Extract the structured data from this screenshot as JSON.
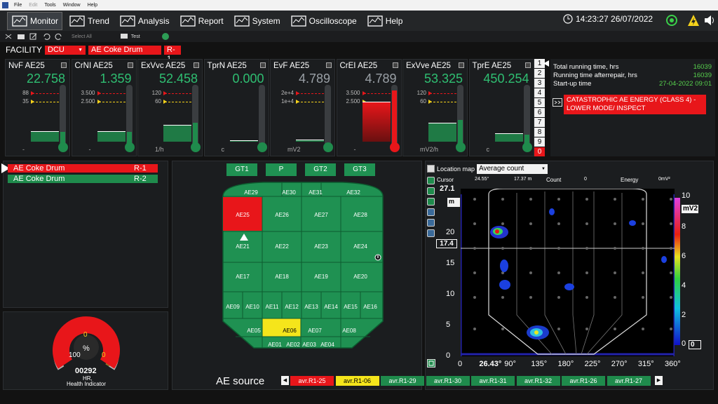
{
  "menu": [
    "File",
    "Edit",
    "Tools",
    "Window",
    "Help"
  ],
  "nav": [
    {
      "label": "Monitor",
      "icon": "monitor-icon"
    },
    {
      "label": "Trend",
      "icon": "trend-icon"
    },
    {
      "label": "Analysis",
      "icon": "analysis-icon"
    },
    {
      "label": "Report",
      "icon": "report-icon"
    },
    {
      "label": "System",
      "icon": "system-icon"
    },
    {
      "label": "Oscilloscope",
      "icon": "oscilloscope-icon"
    },
    {
      "label": "Help",
      "icon": "help-icon"
    }
  ],
  "clock": "14:23:27 26/07/2022",
  "toolbar2": {
    "select_all": "Select All",
    "test": "Test"
  },
  "facility": {
    "label": "FACILITY",
    "unit": "DCU",
    "object": "AE Coke Drum",
    "drum": "R-1"
  },
  "gauges": [
    {
      "name": "NvF AE25",
      "value": "22.758",
      "hi": "88",
      "lo": "35",
      "unit": "-",
      "fill": 0.25,
      "red": false,
      "grey": false
    },
    {
      "name": "CrNI AE25",
      "value": "1.359",
      "hi": "3.500",
      "lo": "2.500",
      "unit": "-",
      "fill": 0.25,
      "red": false,
      "grey": false
    },
    {
      "name": "ExVvc AE25",
      "value": "52.458",
      "hi": "120",
      "lo": "60",
      "unit": "1/h",
      "fill": 0.4,
      "red": false,
      "grey": false
    },
    {
      "name": "TprN AE25",
      "value": "0.000",
      "hi": "",
      "lo": "",
      "unit": "c",
      "fill": 0.02,
      "red": false,
      "grey": false
    },
    {
      "name": "EvF AE25",
      "value": "4.789",
      "hi": "2e+4",
      "lo": "1e+4",
      "unit": "mV2",
      "fill": 0.05,
      "red": false,
      "grey": true
    },
    {
      "name": "CrEI AE25",
      "value": "4.789",
      "hi": "3.500",
      "lo": "2.500",
      "unit": "-",
      "fill": 0.95,
      "red": true,
      "grey": true
    },
    {
      "name": "ExVve AE25",
      "value": "53.325",
      "hi": "120",
      "lo": "60",
      "unit": "mV2/h",
      "fill": 0.45,
      "red": false,
      "grey": false
    },
    {
      "name": "TprE AE25",
      "value": "450.254",
      "hi": "",
      "lo": "",
      "unit": "c",
      "fill": 0.2,
      "red": false,
      "grey": false
    }
  ],
  "severity": [
    "1",
    "2",
    "3",
    "4",
    "5",
    "6",
    "7",
    "8",
    "9",
    "0"
  ],
  "info": {
    "total_label": "Total running time, hrs",
    "total": "16039",
    "after_label": "Running time afterrepair, hrs",
    "after": "16039",
    "startup_label": "Start-up time",
    "startup": "27-04-2022 09:01",
    "alarm": "CATASTROPHIC AE ENERGY (CLASS 4) - LOWER MODE/ INSPECT"
  },
  "objects": [
    {
      "name": "AE Coke Drum",
      "drum": "R-1",
      "status": "red"
    },
    {
      "name": "AE Coke Drum",
      "drum": "R-2",
      "status": "green"
    }
  ],
  "health": {
    "top": "0",
    "pct": "%",
    "min": "100",
    "max": "0",
    "value": "00292",
    "unit": "HR,",
    "label": "Health Indicator"
  },
  "gt": [
    "GT1",
    "P",
    "GT2",
    "GT3"
  ],
  "sensors": [
    "AE29",
    "AE30",
    "AE31",
    "AE32",
    "AE25",
    "AE26",
    "AE27",
    "AE28",
    "AE21",
    "AE22",
    "AE23",
    "AE24",
    "AE17",
    "AE18",
    "AE19",
    "AE20",
    "AE09",
    "AE10",
    "AE11",
    "AE12",
    "AE13",
    "AE14",
    "AE15",
    "AE16",
    "AE05",
    "AE06",
    "AE07",
    "AE08",
    "AE01",
    "AE02",
    "AE03",
    "AE04"
  ],
  "map": {
    "title": "Location map",
    "mode": "Average count",
    "cursor_label": "Cursor",
    "cursor_angle": "24.55°",
    "cursor_h": "17.37 m",
    "count_label": "Count",
    "count": "0",
    "energy_label": "Energy",
    "energy": "0mV²",
    "y_max": "27.1",
    "y_cursor": "17.4",
    "m": "m",
    "yticks": [
      "20",
      "15",
      "10",
      "5",
      "0"
    ],
    "xticks": [
      "26.43°",
      "90°",
      "135°",
      "180°",
      "225°",
      "270°",
      "315°",
      "360°"
    ],
    "x0": "0",
    "cb_max": "10",
    "cb_unit": "mV2",
    "cb_ticks": [
      "8",
      "6",
      "4",
      "2"
    ],
    "cb_zero": "0",
    "cb_min": "0"
  },
  "source": {
    "label": "AE source",
    "items": [
      {
        "t": "avr.R1-25",
        "c": "#e8161a"
      },
      {
        "t": "avr.R1-06",
        "c": "#f5e51b"
      },
      {
        "t": "avr.R1-29",
        "c": "#1f8b4c"
      },
      {
        "t": "avr.R1-30",
        "c": "#1f8b4c"
      },
      {
        "t": "avr.R1-31",
        "c": "#1f8b4c"
      },
      {
        "t": "avr.R1-32",
        "c": "#1f8b4c"
      },
      {
        "t": "avr.R1-26",
        "c": "#1f8b4c"
      },
      {
        "t": "avr.R1-27",
        "c": "#1f8b4c"
      }
    ]
  }
}
